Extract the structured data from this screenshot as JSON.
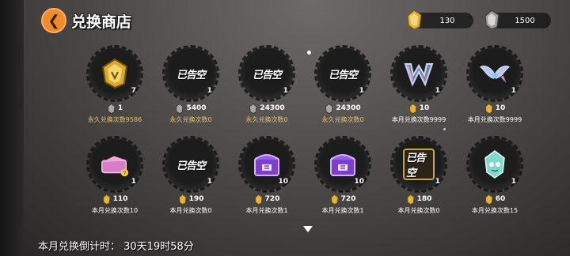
{
  "header": {
    "title": "兑换商店",
    "back_icon": "back-arrow-icon"
  },
  "currencies": [
    {
      "name": "gold-crystal",
      "value": "130",
      "color": "#e2b53a"
    },
    {
      "name": "silver-crystal",
      "value": "1500",
      "color": "#a8a8a8"
    }
  ],
  "items": [
    {
      "icon": "gold-crystal-icon",
      "qty": "7",
      "price": "1",
      "price_currency": "silver",
      "limit": "永久兑换次数9586",
      "limit_color": "gold"
    },
    {
      "icon": "logo-item-icon",
      "qty": "1",
      "price": "5400",
      "price_currency": "silver",
      "limit": "永久兑换次数0",
      "limit_color": "gold",
      "logo": "已告空"
    },
    {
      "icon": "logo-item-icon",
      "qty": "1",
      "price": "24300",
      "price_currency": "silver",
      "limit": "永久兑换次数0",
      "limit_color": "gold",
      "logo": "已告空"
    },
    {
      "icon": "logo-item-icon",
      "qty": "1",
      "price": "24300",
      "price_currency": "silver",
      "limit": "永久兑换次数0",
      "limit_color": "gold",
      "logo": "已告空"
    },
    {
      "icon": "w-badge-icon",
      "qty": "1",
      "price": "10",
      "price_currency": "gold",
      "limit": "本月兑换次数9999",
      "limit_color": "white"
    },
    {
      "icon": "wings-icon",
      "qty": "1",
      "price": "10",
      "price_currency": "gold",
      "limit": "本月兑换次数9999",
      "limit_color": "white"
    },
    {
      "icon": "pink-box-icon",
      "qty": "1",
      "price": "110",
      "price_currency": "gold",
      "limit": "本月兑换次数10",
      "limit_color": "white"
    },
    {
      "icon": "logo-item-icon",
      "qty": "1",
      "price": "190",
      "price_currency": "gold",
      "limit": "本月兑换次数0",
      "limit_color": "white",
      "logo": "已告空"
    },
    {
      "icon": "purple-chest-icon",
      "qty": "10",
      "price": "720",
      "price_currency": "gold",
      "limit": "本月兑换次数1",
      "limit_color": "white"
    },
    {
      "icon": "purple-chest-icon",
      "qty": "10",
      "price": "720",
      "price_currency": "gold",
      "limit": "本月兑换次数1",
      "limit_color": "white"
    },
    {
      "icon": "gold-frame-icon",
      "qty": "1",
      "price": "180",
      "price_currency": "gold",
      "limit": "本月兑换次数0",
      "limit_color": "white",
      "logo": "已告空"
    },
    {
      "icon": "cyan-gem-icon",
      "qty": "1",
      "price": "60",
      "price_currency": "gold",
      "limit": "本月兑换次数15",
      "limit_color": "white"
    }
  ],
  "footer": {
    "countdown": "本月兑换倒计时： 30天19时58分"
  }
}
